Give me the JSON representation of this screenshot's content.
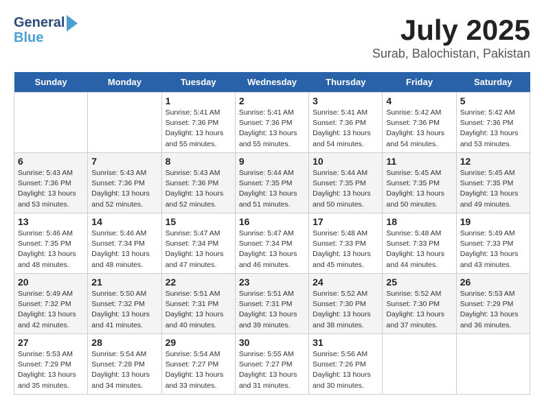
{
  "header": {
    "logo_line1": "General",
    "logo_line2": "Blue",
    "month": "July 2025",
    "location": "Surab, Balochistan, Pakistan"
  },
  "days_of_week": [
    "Sunday",
    "Monday",
    "Tuesday",
    "Wednesday",
    "Thursday",
    "Friday",
    "Saturday"
  ],
  "weeks": [
    [
      {
        "day": "",
        "info": ""
      },
      {
        "day": "",
        "info": ""
      },
      {
        "day": "1",
        "info": "Sunrise: 5:41 AM\nSunset: 7:36 PM\nDaylight: 13 hours and 55 minutes."
      },
      {
        "day": "2",
        "info": "Sunrise: 5:41 AM\nSunset: 7:36 PM\nDaylight: 13 hours and 55 minutes."
      },
      {
        "day": "3",
        "info": "Sunrise: 5:41 AM\nSunset: 7:36 PM\nDaylight: 13 hours and 54 minutes."
      },
      {
        "day": "4",
        "info": "Sunrise: 5:42 AM\nSunset: 7:36 PM\nDaylight: 13 hours and 54 minutes."
      },
      {
        "day": "5",
        "info": "Sunrise: 5:42 AM\nSunset: 7:36 PM\nDaylight: 13 hours and 53 minutes."
      }
    ],
    [
      {
        "day": "6",
        "info": "Sunrise: 5:43 AM\nSunset: 7:36 PM\nDaylight: 13 hours and 53 minutes."
      },
      {
        "day": "7",
        "info": "Sunrise: 5:43 AM\nSunset: 7:36 PM\nDaylight: 13 hours and 52 minutes."
      },
      {
        "day": "8",
        "info": "Sunrise: 5:43 AM\nSunset: 7:36 PM\nDaylight: 13 hours and 52 minutes."
      },
      {
        "day": "9",
        "info": "Sunrise: 5:44 AM\nSunset: 7:35 PM\nDaylight: 13 hours and 51 minutes."
      },
      {
        "day": "10",
        "info": "Sunrise: 5:44 AM\nSunset: 7:35 PM\nDaylight: 13 hours and 50 minutes."
      },
      {
        "day": "11",
        "info": "Sunrise: 5:45 AM\nSunset: 7:35 PM\nDaylight: 13 hours and 50 minutes."
      },
      {
        "day": "12",
        "info": "Sunrise: 5:45 AM\nSunset: 7:35 PM\nDaylight: 13 hours and 49 minutes."
      }
    ],
    [
      {
        "day": "13",
        "info": "Sunrise: 5:46 AM\nSunset: 7:35 PM\nDaylight: 13 hours and 48 minutes."
      },
      {
        "day": "14",
        "info": "Sunrise: 5:46 AM\nSunset: 7:34 PM\nDaylight: 13 hours and 48 minutes."
      },
      {
        "day": "15",
        "info": "Sunrise: 5:47 AM\nSunset: 7:34 PM\nDaylight: 13 hours and 47 minutes."
      },
      {
        "day": "16",
        "info": "Sunrise: 5:47 AM\nSunset: 7:34 PM\nDaylight: 13 hours and 46 minutes."
      },
      {
        "day": "17",
        "info": "Sunrise: 5:48 AM\nSunset: 7:33 PM\nDaylight: 13 hours and 45 minutes."
      },
      {
        "day": "18",
        "info": "Sunrise: 5:48 AM\nSunset: 7:33 PM\nDaylight: 13 hours and 44 minutes."
      },
      {
        "day": "19",
        "info": "Sunrise: 5:49 AM\nSunset: 7:33 PM\nDaylight: 13 hours and 43 minutes."
      }
    ],
    [
      {
        "day": "20",
        "info": "Sunrise: 5:49 AM\nSunset: 7:32 PM\nDaylight: 13 hours and 42 minutes."
      },
      {
        "day": "21",
        "info": "Sunrise: 5:50 AM\nSunset: 7:32 PM\nDaylight: 13 hours and 41 minutes."
      },
      {
        "day": "22",
        "info": "Sunrise: 5:51 AM\nSunset: 7:31 PM\nDaylight: 13 hours and 40 minutes."
      },
      {
        "day": "23",
        "info": "Sunrise: 5:51 AM\nSunset: 7:31 PM\nDaylight: 13 hours and 39 minutes."
      },
      {
        "day": "24",
        "info": "Sunrise: 5:52 AM\nSunset: 7:30 PM\nDaylight: 13 hours and 38 minutes."
      },
      {
        "day": "25",
        "info": "Sunrise: 5:52 AM\nSunset: 7:30 PM\nDaylight: 13 hours and 37 minutes."
      },
      {
        "day": "26",
        "info": "Sunrise: 5:53 AM\nSunset: 7:29 PM\nDaylight: 13 hours and 36 minutes."
      }
    ],
    [
      {
        "day": "27",
        "info": "Sunrise: 5:53 AM\nSunset: 7:29 PM\nDaylight: 13 hours and 35 minutes."
      },
      {
        "day": "28",
        "info": "Sunrise: 5:54 AM\nSunset: 7:28 PM\nDaylight: 13 hours and 34 minutes."
      },
      {
        "day": "29",
        "info": "Sunrise: 5:54 AM\nSunset: 7:27 PM\nDaylight: 13 hours and 33 minutes."
      },
      {
        "day": "30",
        "info": "Sunrise: 5:55 AM\nSunset: 7:27 PM\nDaylight: 13 hours and 31 minutes."
      },
      {
        "day": "31",
        "info": "Sunrise: 5:56 AM\nSunset: 7:26 PM\nDaylight: 13 hours and 30 minutes."
      },
      {
        "day": "",
        "info": ""
      },
      {
        "day": "",
        "info": ""
      }
    ]
  ]
}
